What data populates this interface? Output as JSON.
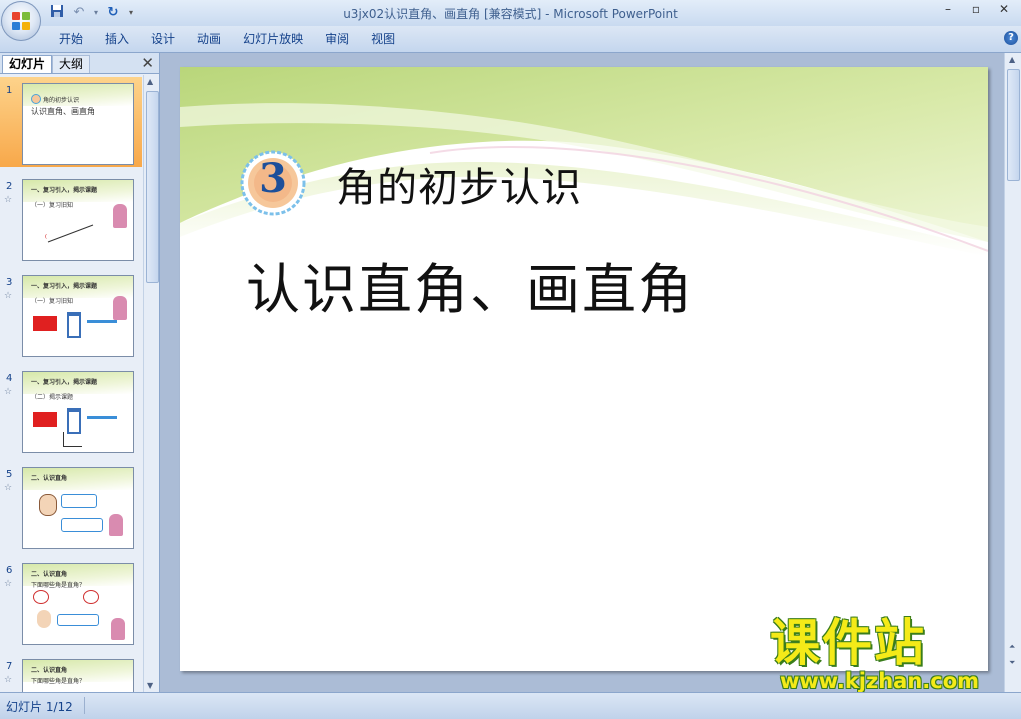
{
  "window": {
    "title": "u3jx02认识直角、画直角 [兼容模式] - Microsoft PowerPoint",
    "controls": [
      "–",
      "▫",
      "✕"
    ]
  },
  "ribbon": {
    "tabs": [
      "开始",
      "插入",
      "设计",
      "动画",
      "幻灯片放映",
      "审阅",
      "视图"
    ],
    "help": "?"
  },
  "left_pane": {
    "tab_slides": "幻灯片",
    "tab_outline": "大纲",
    "close": "✕",
    "thumbnails": [
      {
        "num": "1",
        "title": "角的初步认识",
        "sub": "认识直角、画直角",
        "selected": true
      },
      {
        "num": "2",
        "title": "一、复习引入，揭示课题",
        "sub": "（一）复习旧知"
      },
      {
        "num": "3",
        "title": "一、复习引入，揭示课题",
        "sub": "（一）复习旧知"
      },
      {
        "num": "4",
        "title": "一、复习引入，揭示课题",
        "sub": "（二）揭示课题"
      },
      {
        "num": "5",
        "title": "二、认识直角",
        "sub": ""
      },
      {
        "num": "6",
        "title": "二、认识直角",
        "sub": "下面哪些角是直角？"
      },
      {
        "num": "7",
        "title": "二、认识直角",
        "sub": "下面哪些角是直角？"
      }
    ]
  },
  "slide": {
    "badge_number": "3",
    "heading": "角的初步认识",
    "title": "认识直角、画直角"
  },
  "watermark": {
    "text": "课件站",
    "url": "www.kjzhan.com"
  },
  "status": {
    "slide_counter": "幻灯片 1/12"
  },
  "colors": {
    "ribbon_text": "#15428b",
    "selected_thumb": "#f8a84a",
    "slide_band_green": "#c9e08f",
    "badge_ring": "#4aa3d8",
    "badge_fill": "#f6c79a"
  }
}
